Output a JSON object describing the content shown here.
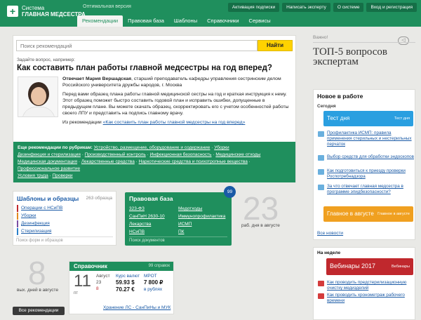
{
  "header": {
    "logo_line1": "Система",
    "logo_line2": "ГЛАВНАЯ МЕДСЕСТРА",
    "optimal_version": "Оптимальная версия",
    "top_buttons": [
      "Активация подписки",
      "Написать эксперту",
      "О системе",
      "Вход и регистрация"
    ],
    "nav": [
      "Рекомендации",
      "Правовая база",
      "Шаблоны",
      "Справочники",
      "Сервисы"
    ]
  },
  "main": {
    "search_placeholder": "Поиск рекомендаций",
    "find_label": "Найти",
    "ask_label": "Задайте вопрос, например:",
    "question": "Как составить план работы главной медсестры на год вперед?",
    "answer_author": "Отвечает Мария Вершадская",
    "answer_author_rest": ", старший преподаватель кафедры управления сестринским делом Российского университета дружбы народов, г. Москва",
    "answer_text": "Перед вами образец плана работы главной медицинской сестры на год и краткая инструкция к нему. Этот образец поможет быстро составить годовой план и исправить ошибки, допущенные в предыдущем плане. Вы можете скачать образец, скорректировать его с учетом особенностей работы своего ЛПУ и представить на подпись главному врачу.",
    "from_rec_label": "Из рекомендации",
    "from_rec_link": "«Как составить план работы главной медсестры на год вперед»",
    "rubrics_label": "Еще рекомендации по рубрикам:",
    "rubrics": [
      "Устройство, размещение, оборудование и содержание",
      "Уборки",
      "Дезинфекция и стерилизация",
      "Производственный контроль",
      "Инфекционная безопасность",
      "Медицинские отходы",
      "Медицинская документация",
      "Лекарственные средства",
      "Наркотические средства и психотропные вещества",
      "Профессиональное развитие",
      "Условия труда",
      "Проверки"
    ]
  },
  "templates": {
    "title": "Шаблоны и образцы",
    "count": "263 образца",
    "items": [
      "Операции с НСиПВ",
      "Уборки",
      "Дезинфекция",
      "Стерилизация"
    ],
    "item_colors": [
      "#c0282d",
      "#e38b1f",
      "#7a4fa3",
      "#2a7fc9"
    ],
    "search_placeholder": "Поиск форм и образцов"
  },
  "legal": {
    "title": "Правовая база",
    "badge": "99",
    "items": [
      "323-ФЗ",
      "Медотходы",
      "СанПиН 2630-10",
      "Иммунопрофилактика",
      "Лекарства",
      "ИСМП",
      "НСиПВ",
      "ПК"
    ],
    "search_placeholder": "Поиск документов"
  },
  "stats": {
    "days_big": "23",
    "days_caption": "раб. дня в августе",
    "weekend_big": "8",
    "weekend_caption": "вых. дней в августе"
  },
  "reference": {
    "title": "Справочник",
    "count": "99 справок",
    "day": "11",
    "weekday": "пт",
    "month": "Август",
    "d1": "23",
    "d2": "8",
    "rate_label": "Курс валют",
    "usd": "59.93 $",
    "eur": "70.27 €",
    "mrot_label": "МРОТ",
    "mrot": "7 800 ₽",
    "mrot_unit": "в рублях",
    "storage_link": "Хранение ЛС - СанПиНы и МУК"
  },
  "all_rec_button": "Все рекомендации",
  "right": {
    "important": "Важно!",
    "top5": "ТОП-5 вопросов экспертам",
    "new_title": "Новое в работе",
    "today": "Сегодня",
    "test_day": "Тест дня",
    "test_day_sub": "Тест дня",
    "new_items": [
      "Профилактика ИСМП: правила применения стерильных и нестерильных перчаток",
      "Выбор средств для обработки эндоскопов",
      "Как подготовиться к приезду проверки Роспотребнадзора",
      "За что отвечает главная медсестра в программе эпидбезопасности?"
    ],
    "august": "Главное в августе",
    "august_sub": "Главное в августе",
    "all_news": "Все новости",
    "week_title": "На неделе",
    "webinars": "Вебинары 2017",
    "webinars_sub": "Вебинары",
    "week_items": [
      "Как проводить предстерилизационную очистку медизделий",
      "Как проводить хронометраж рабочего времени"
    ],
    "colors": {
      "green": "#1f8f5d",
      "blue": "#2a9fe0",
      "orange": "#f0a020",
      "red": "#c0282d"
    }
  }
}
